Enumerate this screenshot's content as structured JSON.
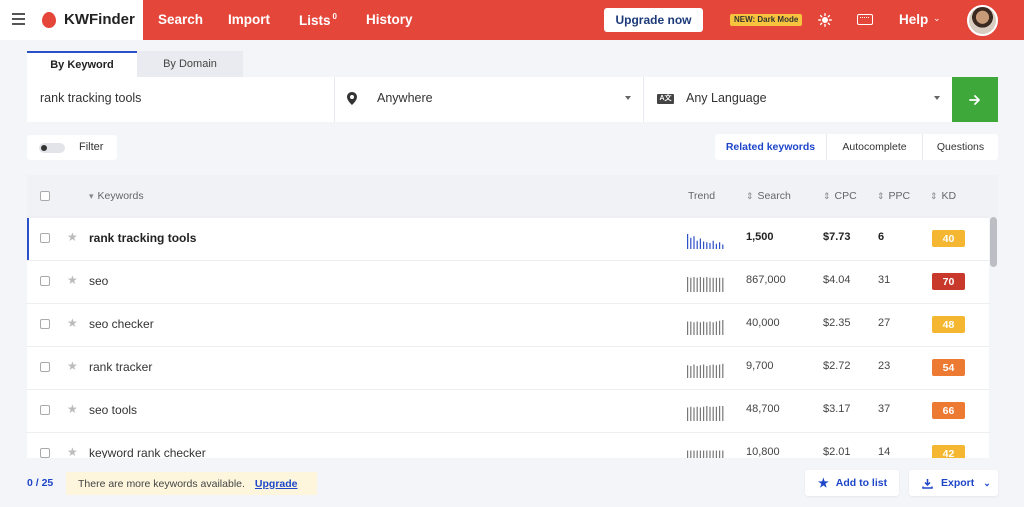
{
  "app": {
    "name": "KWFinder"
  },
  "nav": {
    "items": [
      {
        "label": "Search"
      },
      {
        "label": "Import"
      },
      {
        "label": "Lists",
        "count": "0"
      },
      {
        "label": "History"
      }
    ],
    "upgrade_label": "Upgrade now",
    "dark_mode_badge": "NEW: Dark Mode",
    "help_label": "Help"
  },
  "tabs": [
    {
      "label": "By Keyword",
      "active": true
    },
    {
      "label": "By Domain",
      "active": false
    }
  ],
  "search": {
    "keyword_value": "rank tracking tools",
    "location": "Anywhere",
    "language": "Any Language",
    "lang_icon_text": "A文"
  },
  "filter": {
    "label": "Filter"
  },
  "switcher": [
    {
      "label": "Related keywords",
      "active": true
    },
    {
      "label": "Autocomplete",
      "active": false
    },
    {
      "label": "Questions",
      "active": false
    }
  ],
  "table": {
    "headers": {
      "keywords": "Keywords",
      "trend": "Trend",
      "search": "Search",
      "cpc": "CPC",
      "ppc": "PPC",
      "kd": "KD"
    },
    "rows": [
      {
        "keyword": "rank tracking tools",
        "search": "1,500",
        "cpc": "$7.73",
        "ppc": "6",
        "kd": "40",
        "kd_color": "#f5b731",
        "trend": [
          1,
          0.75,
          0.85,
          0.55,
          0.7,
          0.5,
          0.45,
          0.4,
          0.55,
          0.35,
          0.45,
          0.3
        ],
        "selected": true
      },
      {
        "keyword": "seo",
        "search": "867,000",
        "cpc": "$4.04",
        "ppc": "31",
        "kd": "70",
        "kd_color": "#c8392b",
        "trend": [
          1,
          0.95,
          1,
          0.95,
          1,
          0.95,
          1,
          0.95,
          0.95,
          0.95,
          0.95,
          0.95
        ],
        "selected": false
      },
      {
        "keyword": "seo checker",
        "search": "40,000",
        "cpc": "$2.35",
        "ppc": "27",
        "kd": "48",
        "kd_color": "#f5b731",
        "trend": [
          0.9,
          0.9,
          0.85,
          0.9,
          0.85,
          0.9,
          0.85,
          0.9,
          0.85,
          0.9,
          0.95,
          1
        ],
        "selected": false
      },
      {
        "keyword": "rank tracker",
        "search": "9,700",
        "cpc": "$2.72",
        "ppc": "23",
        "kd": "54",
        "kd_color": "#ed7a33",
        "trend": [
          0.85,
          0.8,
          0.9,
          0.8,
          0.85,
          0.9,
          0.8,
          0.85,
          0.9,
          0.85,
          0.9,
          0.95
        ],
        "selected": false
      },
      {
        "keyword": "seo tools",
        "search": "48,700",
        "cpc": "$3.17",
        "ppc": "37",
        "kd": "66",
        "kd_color": "#ed7a33",
        "trend": [
          0.9,
          0.95,
          0.9,
          0.95,
          0.9,
          0.95,
          1,
          0.95,
          0.95,
          0.95,
          1,
          1
        ],
        "selected": false
      },
      {
        "keyword": "keyword rank checker",
        "search": "10,800",
        "cpc": "$2.01",
        "ppc": "14",
        "kd": "42",
        "kd_color": "#f5b731",
        "trend": [
          0.9,
          0.9,
          0.9,
          0.9,
          0.9,
          0.9,
          0.9,
          0.9,
          0.9,
          0.9,
          0.9,
          0.9
        ],
        "selected": false
      }
    ]
  },
  "footer": {
    "counter": "0 / 25",
    "notice_text": "There are more keywords available.",
    "notice_link": "Upgrade",
    "add_to_list_label": "Add to list",
    "export_label": "Export"
  }
}
